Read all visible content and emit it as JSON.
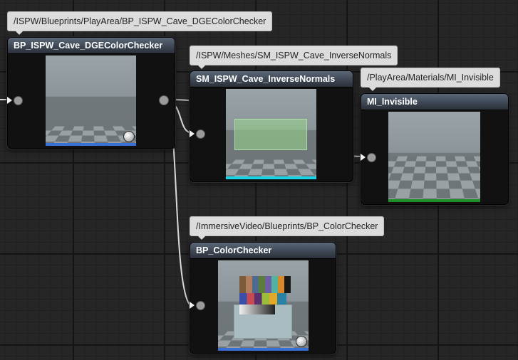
{
  "nodes": {
    "bp_cave": {
      "path": "/ISPW/Blueprints/PlayArea/BP_ISPW_Cave_DGEColorChecker",
      "title": "BP_ISPW_Cave_DGEColorChecker"
    },
    "sm_cave": {
      "path": "/ISPW/Meshes/SM_ISPW_Cave_InverseNormals",
      "title": "SM_ISPW_Cave_InverseNormals"
    },
    "mi_invisible": {
      "path": "/PlayArea/Materials/MI_Invisible",
      "title": "MI_Invisible"
    },
    "bp_colorchecker": {
      "path": "/ImmersiveVideo/Blueprints/BP_ColorChecker",
      "title": "BP_ColorChecker"
    }
  },
  "colors": {
    "blueprint_bar": "#3b6fd6",
    "mesh_bar": "#19d3e6",
    "material_bar": "#1f8f2a",
    "wire": "#d9d9d9"
  }
}
